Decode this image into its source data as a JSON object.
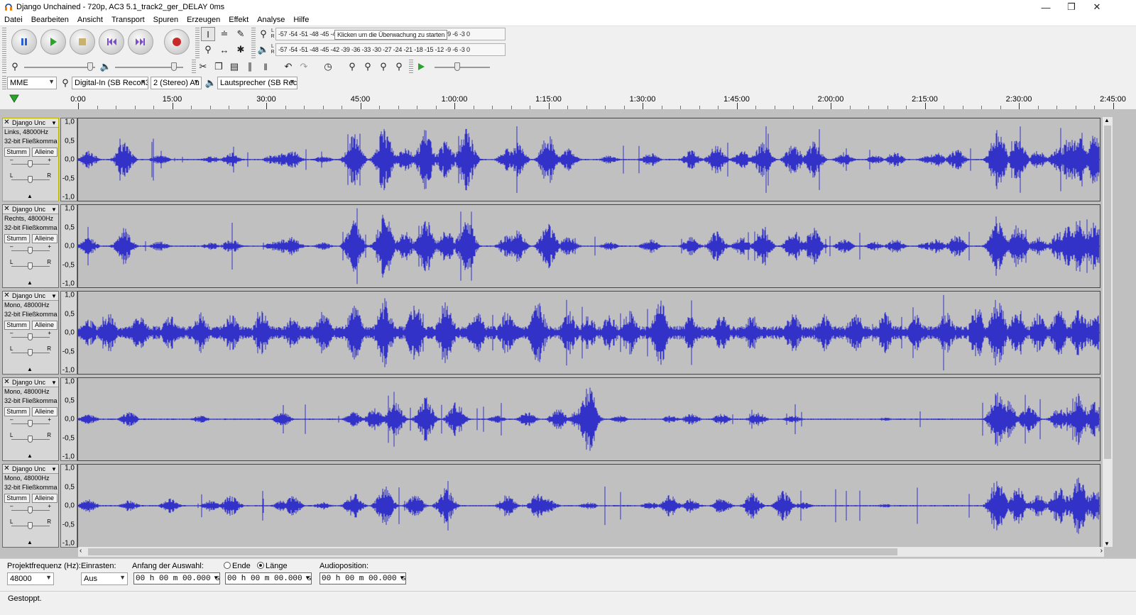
{
  "window": {
    "title": "Django Unchained - 720p, AC3 5.1_track2_ger_DELAY 0ms",
    "controls": [
      "minimize-icon",
      "maximize-icon",
      "close-icon"
    ]
  },
  "menu": [
    "Datei",
    "Bearbeiten",
    "Ansicht",
    "Transport",
    "Spuren",
    "Erzeugen",
    "Effekt",
    "Analyse",
    "Hilfe"
  ],
  "transport": {
    "buttons": [
      "pause-icon",
      "play-icon",
      "stop-icon",
      "skip-start-icon",
      "skip-end-icon",
      "record-icon"
    ]
  },
  "meters": {
    "record_channels": "L R",
    "record_scale": "-57 -54 -51 -48 -45 -42 -39 -36 -33 -30 -27 -24 -21 -18 -15 -12 -9 -6 -3 0",
    "record_hint": "Klicken um die Überwachung zu starten",
    "play_channels": "L R",
    "play_scale": "-57 -54 -51 -48 -45 -42 -39 -36 -33 -30 -27 -24 -21 -18 -15 -12 -9 -6 -3 0"
  },
  "mixer": {
    "record_volume": 0.97,
    "playback_volume": 0.9,
    "play_speed": 0.4
  },
  "device": {
    "host": "MME",
    "input": "Digital-In (SB Recon3",
    "channels": "2 (Stereo) Au",
    "output": "Lautsprecher (SB Rec"
  },
  "ruler": {
    "labels": [
      "0:00",
      "15:00",
      "30:00",
      "45:00",
      "1:00:00",
      "1:15:00",
      "1:30:00",
      "1:45:00",
      "2:00:00",
      "2:15:00",
      "2:30:00",
      "2:45:00"
    ]
  },
  "tracks": [
    {
      "name": "Django Unc",
      "info1": "Links, 48000Hz",
      "info2": "32-bit Fließkomma",
      "mute": "Stumm",
      "solo": "Alleine",
      "selected": true
    },
    {
      "name": "Django Unc",
      "info1": "Rechts, 48000Hz",
      "info2": "32-bit Fließkomma",
      "mute": "Stumm",
      "solo": "Alleine",
      "selected": false
    },
    {
      "name": "Django Unc",
      "info1": "Mono, 48000Hz",
      "info2": "32-bit Fließkomma",
      "mute": "Stumm",
      "solo": "Alleine",
      "selected": false
    },
    {
      "name": "Django Unc",
      "info1": "Mono, 48000Hz",
      "info2": "32-bit Fließkomma",
      "mute": "Stumm",
      "solo": "Alleine",
      "selected": false
    },
    {
      "name": "Django Unc",
      "info1": "Mono, 48000Hz",
      "info2": "32-bit Fließkomma",
      "mute": "Stumm",
      "solo": "Alleine",
      "selected": false
    }
  ],
  "amplitude_labels": [
    "1,0",
    "0,5",
    "0,0",
    "-0,5",
    "-1,0"
  ],
  "colors": {
    "waveform": "#3232c8",
    "track_bg": "#c0c0c0",
    "selected_border": "#b7b300"
  },
  "selection": {
    "rate_label": "Projektfrequenz (Hz):",
    "rate_value": "48000",
    "snap_label": "Einrasten:",
    "snap_value": "Aus",
    "start_label": "Anfang der Auswahl:",
    "end_label": "Ende",
    "length_label": "Länge",
    "length_selected": true,
    "position_label": "Audioposition:",
    "start_time": "00 h 00 m 00.000 s",
    "length_time": "00 h 00 m 00.000 s",
    "position_time": "00 h 00 m 00.000 s"
  },
  "status": "Gestoppt."
}
